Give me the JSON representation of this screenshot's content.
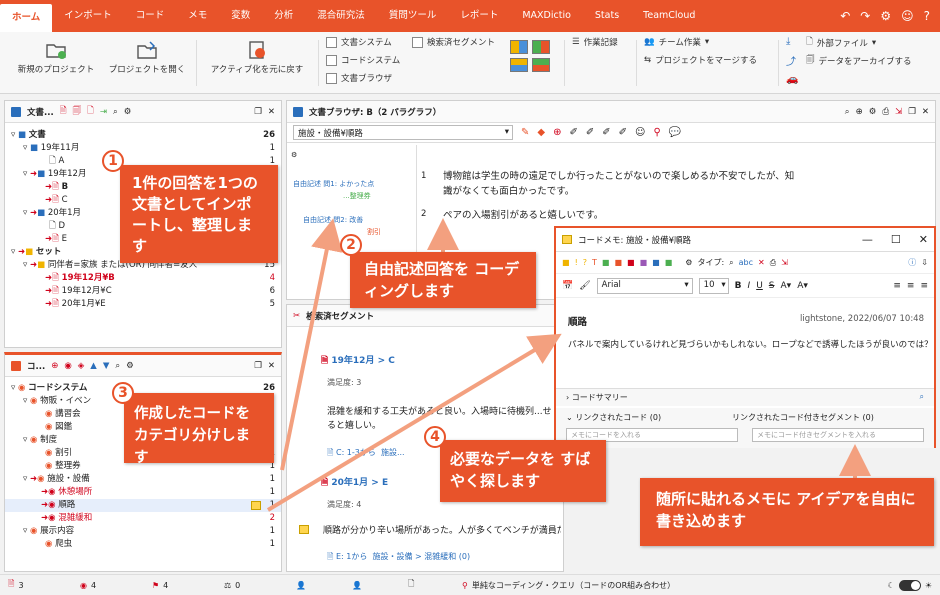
{
  "tabs": [
    "ホーム",
    "インポート",
    "コード",
    "メモ",
    "変数",
    "分析",
    "混合研究法",
    "質問ツール",
    "レポート",
    "MAXDictio",
    "Stats",
    "TeamCloud"
  ],
  "ribbon": {
    "new_project": "新規のプロジェクト",
    "open_project": "プロジェクトを開く",
    "reset_active": "アクティブ化を元に戻す",
    "doc_system": "文書システム",
    "code_system": "コードシステム",
    "doc_browser": "文書ブラウザ",
    "retrieved_segments": "検索済セグメント",
    "work_log": "作業記録",
    "team_work": "チーム作業",
    "merge_project": "プロジェクトをマージする",
    "external_files": "外部ファイル",
    "archive_data": "データをアーカイブする"
  },
  "doc_pane": {
    "title": "文書...",
    "rows": [
      {
        "label": "文書",
        "count": "26"
      },
      {
        "label": "19年11月",
        "count": "1"
      },
      {
        "label": "A",
        "count": "1"
      },
      {
        "label": "19年12月",
        "count": "5"
      },
      {
        "label": "B",
        "count": ""
      },
      {
        "label": "C",
        "count": ""
      },
      {
        "label": "20年1月",
        "count": "6"
      },
      {
        "label": "D",
        "count": ""
      },
      {
        "label": "E",
        "count": ""
      },
      {
        "label": "セット",
        "count": "26"
      },
      {
        "label": "同伴者=家族 または(OR) 同伴者=友人",
        "count": "15"
      },
      {
        "label": "19年12月¥B",
        "count": "4"
      },
      {
        "label": "19年12月¥C",
        "count": "6"
      },
      {
        "label": "20年1月¥E",
        "count": "5"
      }
    ]
  },
  "code_pane": {
    "title": "コ...",
    "rows": [
      {
        "label": "コードシステム",
        "count": "26"
      },
      {
        "label": "物販・イベン",
        "count": ""
      },
      {
        "label": "講習会",
        "count": ""
      },
      {
        "label": "図鑑",
        "count": ""
      },
      {
        "label": "制度",
        "count": ""
      },
      {
        "label": "割引",
        "count": "1"
      },
      {
        "label": "整理券",
        "count": "1"
      },
      {
        "label": "施設・設備",
        "count": "1"
      },
      {
        "label": "休憩場所",
        "count": "1"
      },
      {
        "label": "順路",
        "count": "1"
      },
      {
        "label": "混雑緩和",
        "count": "2"
      },
      {
        "label": "展示内容",
        "count": "1"
      },
      {
        "label": "爬虫",
        "count": "1"
      }
    ]
  },
  "browser": {
    "title": "文書ブラウザ: B（2 パラグラフ）",
    "code_select": "施設・設備¥順路",
    "paragraphs": [
      {
        "num": "1",
        "code1": "自由記述",
        "code2": "問1: よかった点",
        "code3": "...整理券",
        "text": "博物館は学生の時の遠足でしか行ったことがないので楽しめるか不安でしたが、知識がなくても面白かったです。"
      },
      {
        "num": "2",
        "code1": "自由記述",
        "code2": "問2: 改善",
        "code3": "割引",
        "text": "ペアの入場割引があると嬉しいです。"
      }
    ]
  },
  "retrieved": {
    "title": "検索済セグメント",
    "items": [
      {
        "heading": "19年12月 > C",
        "meta": "満足度: 3",
        "text": "混雑を緩和する工夫があると良い。入場時に待機列...せると嬉しい。",
        "src": "C: 1-3から",
        "code": "施設..."
      },
      {
        "heading": "20年1月 > E",
        "meta": "満足度: 4",
        "text": "順路が分かり辛い場所があった。人が多くてベンチが満員だったので数を増",
        "src": "E: 1から",
        "code": "施設・設備 > 混雑緩和 (0)"
      }
    ]
  },
  "memo": {
    "title": "コードメモ: 施設・設備¥順路",
    "font": "Arial",
    "size": "10",
    "name": "順路",
    "author_date": "lightstone, 2022/06/07 10:48",
    "body": "パネルで案内しているけれど見づらいかもしれない。ロープなどで誘導したほうが良いのでは？",
    "type_label": "タイプ:",
    "code_summary": "コードサマリー",
    "linked_codes": "リンクされたコード (0)",
    "linked_segments": "リンクされたコード付きセグメント (0)",
    "input_code": "メモにコードを入れる",
    "input_segment": "メモにコード付きセグメントを入れる"
  },
  "callouts": {
    "c1": "1件の回答を1つの文書としてインポートし、整理します",
    "c2": "自由記述回答を コーディングします",
    "c3": "作成したコードを カテゴリ分けします",
    "c4": "必要なデータを すばやく探します",
    "c5": "随所に貼れるメモに アイデアを自由に書き込めます",
    "n1": "1",
    "n2": "2",
    "n3": "3",
    "n4": "4"
  },
  "status": {
    "s1": "3",
    "s2": "4",
    "s3": "4",
    "s4": "0",
    "query": "単純なコーディング・クエリ（コードのOR組み合わせ）"
  },
  "colors": {
    "accent": "#e8532a",
    "red": "#d0021b"
  }
}
